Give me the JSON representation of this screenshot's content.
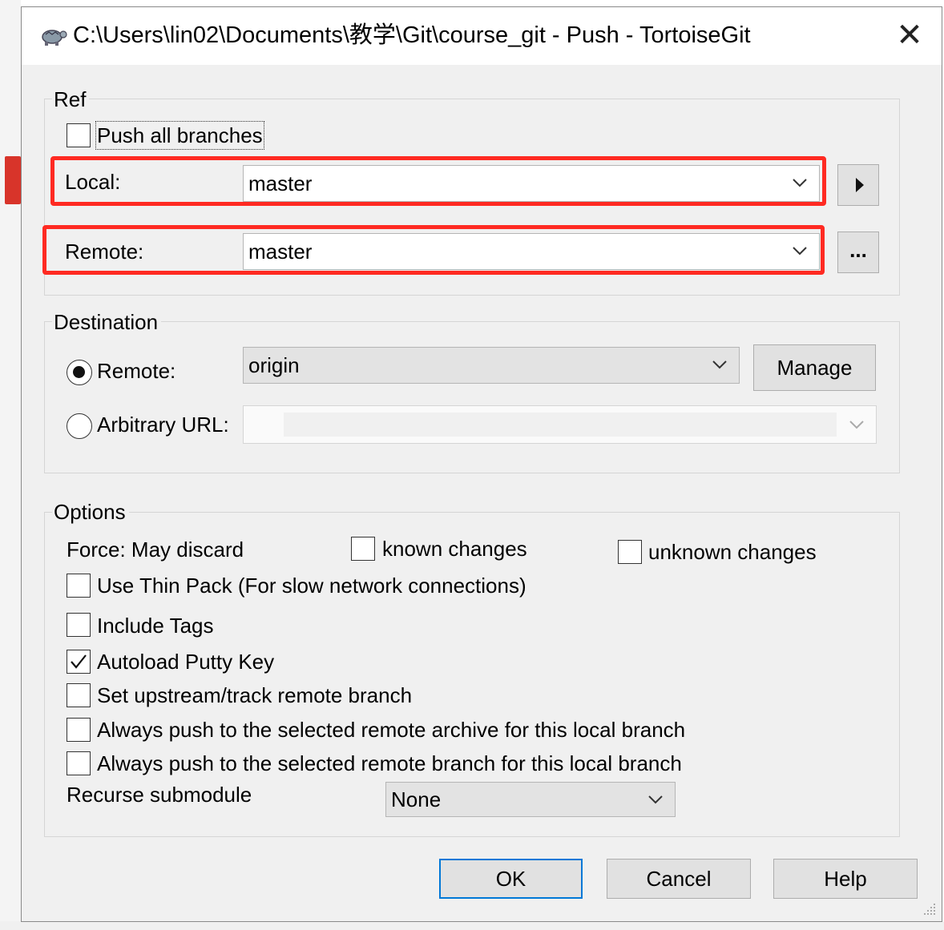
{
  "window": {
    "title": "C:\\Users\\lin02\\Documents\\教学\\Git\\course_git - Push - TortoiseGit",
    "close_glyph": "✕",
    "app_icon": "tortoise-icon"
  },
  "ref": {
    "group_title": "Ref",
    "push_all_branches": {
      "label": "Push all branches",
      "checked": false
    },
    "local": {
      "label": "Local:",
      "value": "master"
    },
    "remote": {
      "label": "Remote:",
      "value": "master"
    },
    "local_arrow_glyph": "▶",
    "remote_browse_label": "..."
  },
  "destination": {
    "group_title": "Destination",
    "remote_radio": {
      "label": "Remote:",
      "selected": true
    },
    "remote_value": "origin",
    "manage_label": "Manage",
    "url_radio": {
      "label": "Arbitrary URL:",
      "selected": false
    },
    "url_value": ""
  },
  "options": {
    "group_title": "Options",
    "force_label": "Force: May discard",
    "known_changes": {
      "label": "known changes",
      "checked": false
    },
    "unknown_changes": {
      "label": "unknown changes",
      "checked": false
    },
    "thin_pack": {
      "label": "Use Thin Pack (For slow network connections)",
      "checked": false
    },
    "include_tags": {
      "label": "Include Tags",
      "checked": false
    },
    "autoload_putty": {
      "label": "Autoload Putty Key",
      "checked": true
    },
    "set_upstream": {
      "label": "Set upstream/track remote branch",
      "checked": false
    },
    "always_archive": {
      "label": "Always push to the selected remote archive for this local branch",
      "checked": false
    },
    "always_branch": {
      "label": "Always push to the selected remote branch for this local branch",
      "checked": false
    },
    "recurse_label": "Recurse submodule",
    "recurse_value": "None"
  },
  "buttons": {
    "ok": "OK",
    "cancel": "Cancel",
    "help": "Help"
  },
  "colors": {
    "highlight": "#ff2a22",
    "default_button_border": "#0078d7",
    "dialog_bg": "#f0f0f0"
  }
}
